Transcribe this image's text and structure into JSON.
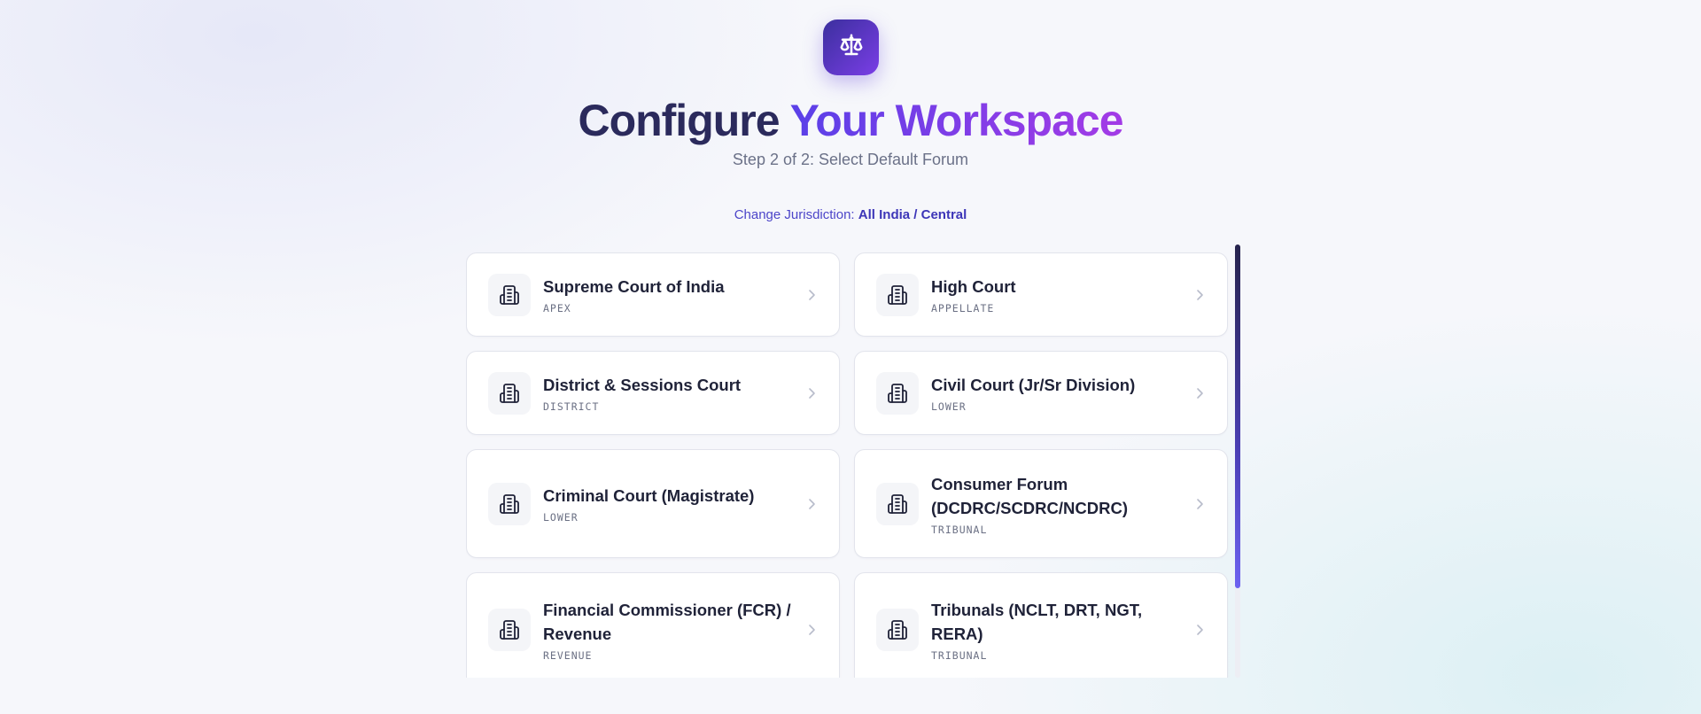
{
  "header": {
    "logo_icon": "scales-of-justice-icon",
    "title_part1": "Configure",
    "title_part2": "Your Workspace",
    "subtitle": "Step 2 of 2: Select Default Forum"
  },
  "jurisdiction": {
    "label": "Change Jurisdiction:",
    "value": "All India / Central"
  },
  "forums": [
    {
      "name": "Supreme Court of India",
      "tag": "APEX",
      "icon": "courthouse-icon"
    },
    {
      "name": "High Court",
      "tag": "APPELLATE",
      "icon": "courthouse-icon"
    },
    {
      "name": "District & Sessions Court",
      "tag": "DISTRICT",
      "icon": "courthouse-icon"
    },
    {
      "name": "Civil Court (Jr/Sr Division)",
      "tag": "LOWER",
      "icon": "courthouse-icon"
    },
    {
      "name": "Criminal Court (Magistrate)",
      "tag": "LOWER",
      "icon": "courthouse-icon"
    },
    {
      "name": "Consumer Forum (DCDRC/SCDRC/NCDRC)",
      "tag": "TRIBUNAL",
      "icon": "courthouse-icon"
    },
    {
      "name": "Financial Commissioner (FCR) / Revenue",
      "tag": "REVENUE",
      "icon": "courthouse-icon"
    },
    {
      "name": "Tribunals (NCLT, DRT, NGT, RERA)",
      "tag": "TRIBUNAL",
      "icon": "courthouse-icon"
    }
  ],
  "colors": {
    "accent_start": "#5a40e8",
    "accent_end": "#a33be6",
    "title_dark": "#2b2a5c",
    "link": "#4c45c9"
  }
}
